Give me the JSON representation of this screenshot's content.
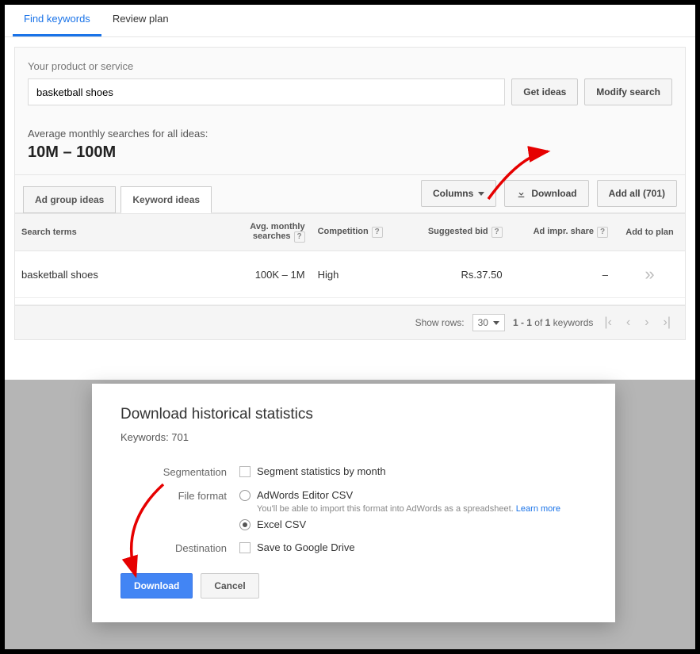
{
  "tabs": {
    "find": "Find keywords",
    "review": "Review plan"
  },
  "search": {
    "label": "Your product or service",
    "value": "basketball shoes",
    "get_ideas": "Get ideas",
    "modify": "Modify search"
  },
  "stats": {
    "label": "Average monthly searches for all ideas:",
    "value": "10M – 100M"
  },
  "ideaTabs": {
    "adgroup": "Ad group ideas",
    "keyword": "Keyword ideas"
  },
  "toolbar": {
    "columns": "Columns",
    "download": "Download",
    "add_all": "Add all (701)"
  },
  "table": {
    "headers": {
      "terms": "Search terms",
      "avg": "Avg. monthly searches",
      "comp": "Competition",
      "bid": "Suggested bid",
      "impr": "Ad impr. share",
      "add": "Add to plan"
    },
    "row": {
      "term": "basketball shoes",
      "avg": "100K – 1M",
      "comp": "High",
      "bid": "Rs.37.50",
      "impr": "–"
    }
  },
  "pagination": {
    "show_rows": "Show rows:",
    "rows": "30",
    "range_prefix": "1 - 1",
    "range_mid": " of ",
    "range_total": "1",
    "range_suffix": " keywords"
  },
  "dialog": {
    "title": "Download historical statistics",
    "sub": "Keywords: 701",
    "labels": {
      "seg": "Segmentation",
      "fmt": "File format",
      "dest": "Destination"
    },
    "seg_option": "Segment statistics by month",
    "fmt_adwords": "AdWords Editor CSV",
    "fmt_hint": "You'll be able to import this format into AdWords as a spreadsheet.",
    "learn_more": "Learn more",
    "fmt_excel": "Excel CSV",
    "dest_option": "Save to Google Drive",
    "download": "Download",
    "cancel": "Cancel"
  }
}
